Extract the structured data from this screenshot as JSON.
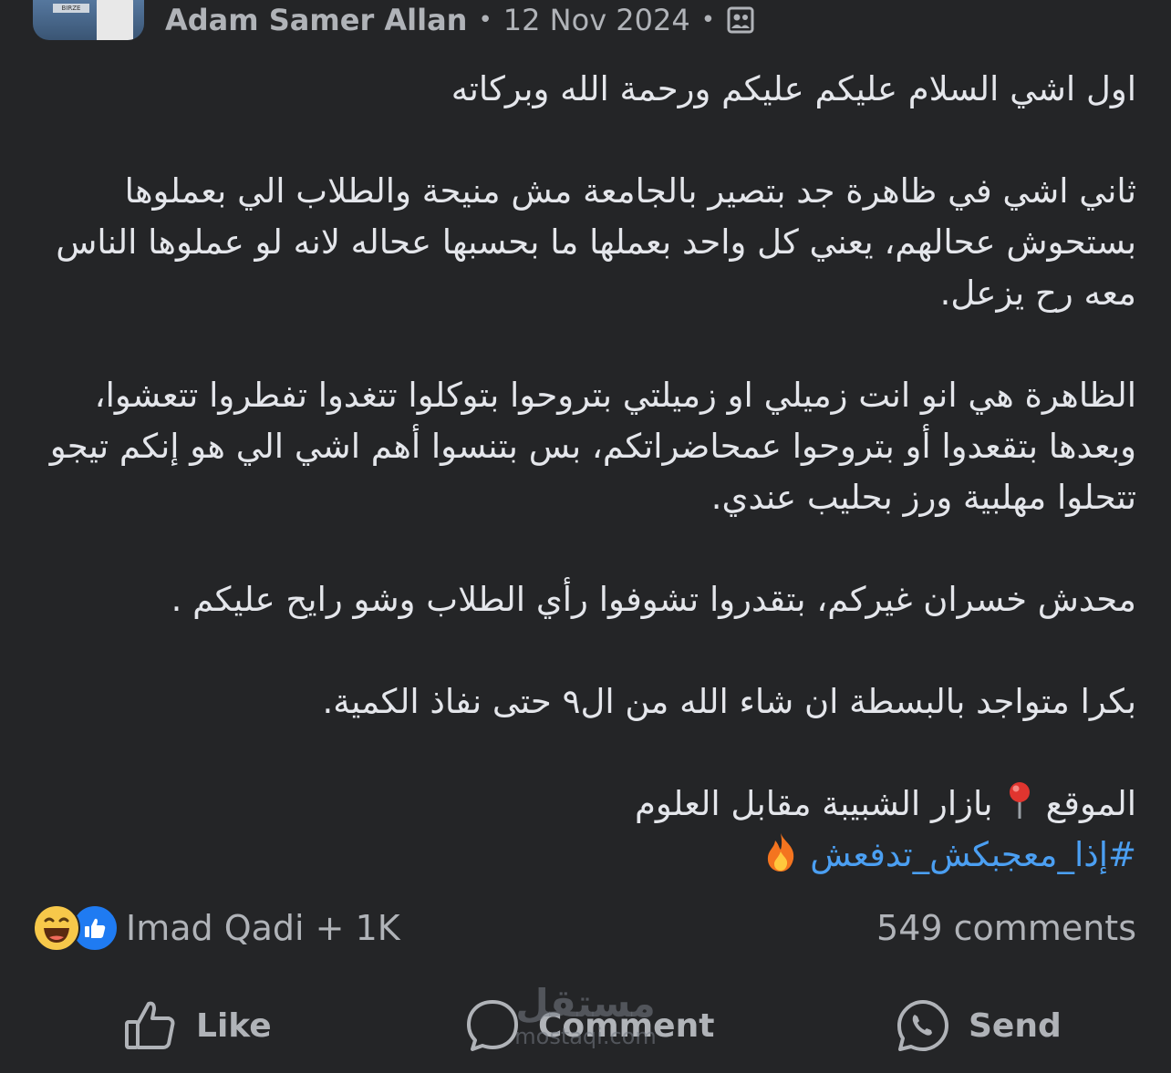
{
  "header": {
    "author": "Adam Samer Allan",
    "separator": "•",
    "date": "12 Nov 2024",
    "audience_icon": "group-photo-icon",
    "avatar_sign_text": "BIRZE"
  },
  "post": {
    "greeting": "اول اشي السلام عليكم عليكم ورحمة الله وبركاته",
    "para2": "ثاني اشي في ظاهرة جد بتصير بالجامعة مش منيحة والطلاب الي بعملوها بستحوش عحالهم، يعني كل واحد بعملها ما بحسبها عحاله لانه لو عملوها الناس معه رح يزعل.",
    "para3": "الظاهرة هي انو انت زميلي او زميلتي بتروحوا بتوكلوا تتغدوا تفطروا تتعشوا، وبعدها بتقعدوا أو بتروحوا عمحاضراتكم، بس بتنسوا أهم اشي الي هو إنكم تيجو تتحلوا مهلبية ورز بحليب عندي.",
    "para4": "محدش خسران غيركم، بتقدروا تشوفوا رأي الطلاب وشو رايح عليكم .",
    "para5": "بكرا متواجد بالبسطة ان شاء الله من ال٩ حتى نفاذ الكمية.",
    "location_label": "الموقع",
    "location_value": "بازار الشبيبة مقابل العلوم",
    "hashtag": "#إذا_معجبكش_تدفعش"
  },
  "reactions": {
    "summary": "Imad Qadi + 1K",
    "comments": "549 comments"
  },
  "actions": {
    "like": "Like",
    "comment": "Comment",
    "send": "Send"
  },
  "watermark": {
    "arabic": "مستقل",
    "latin": "mostaqi.com"
  },
  "colors": {
    "background": "#242527",
    "text": "#e4e6eb",
    "muted": "#b0b3b8",
    "hashtag": "#4b9ff2",
    "like_blue": "#1f7bf2"
  }
}
